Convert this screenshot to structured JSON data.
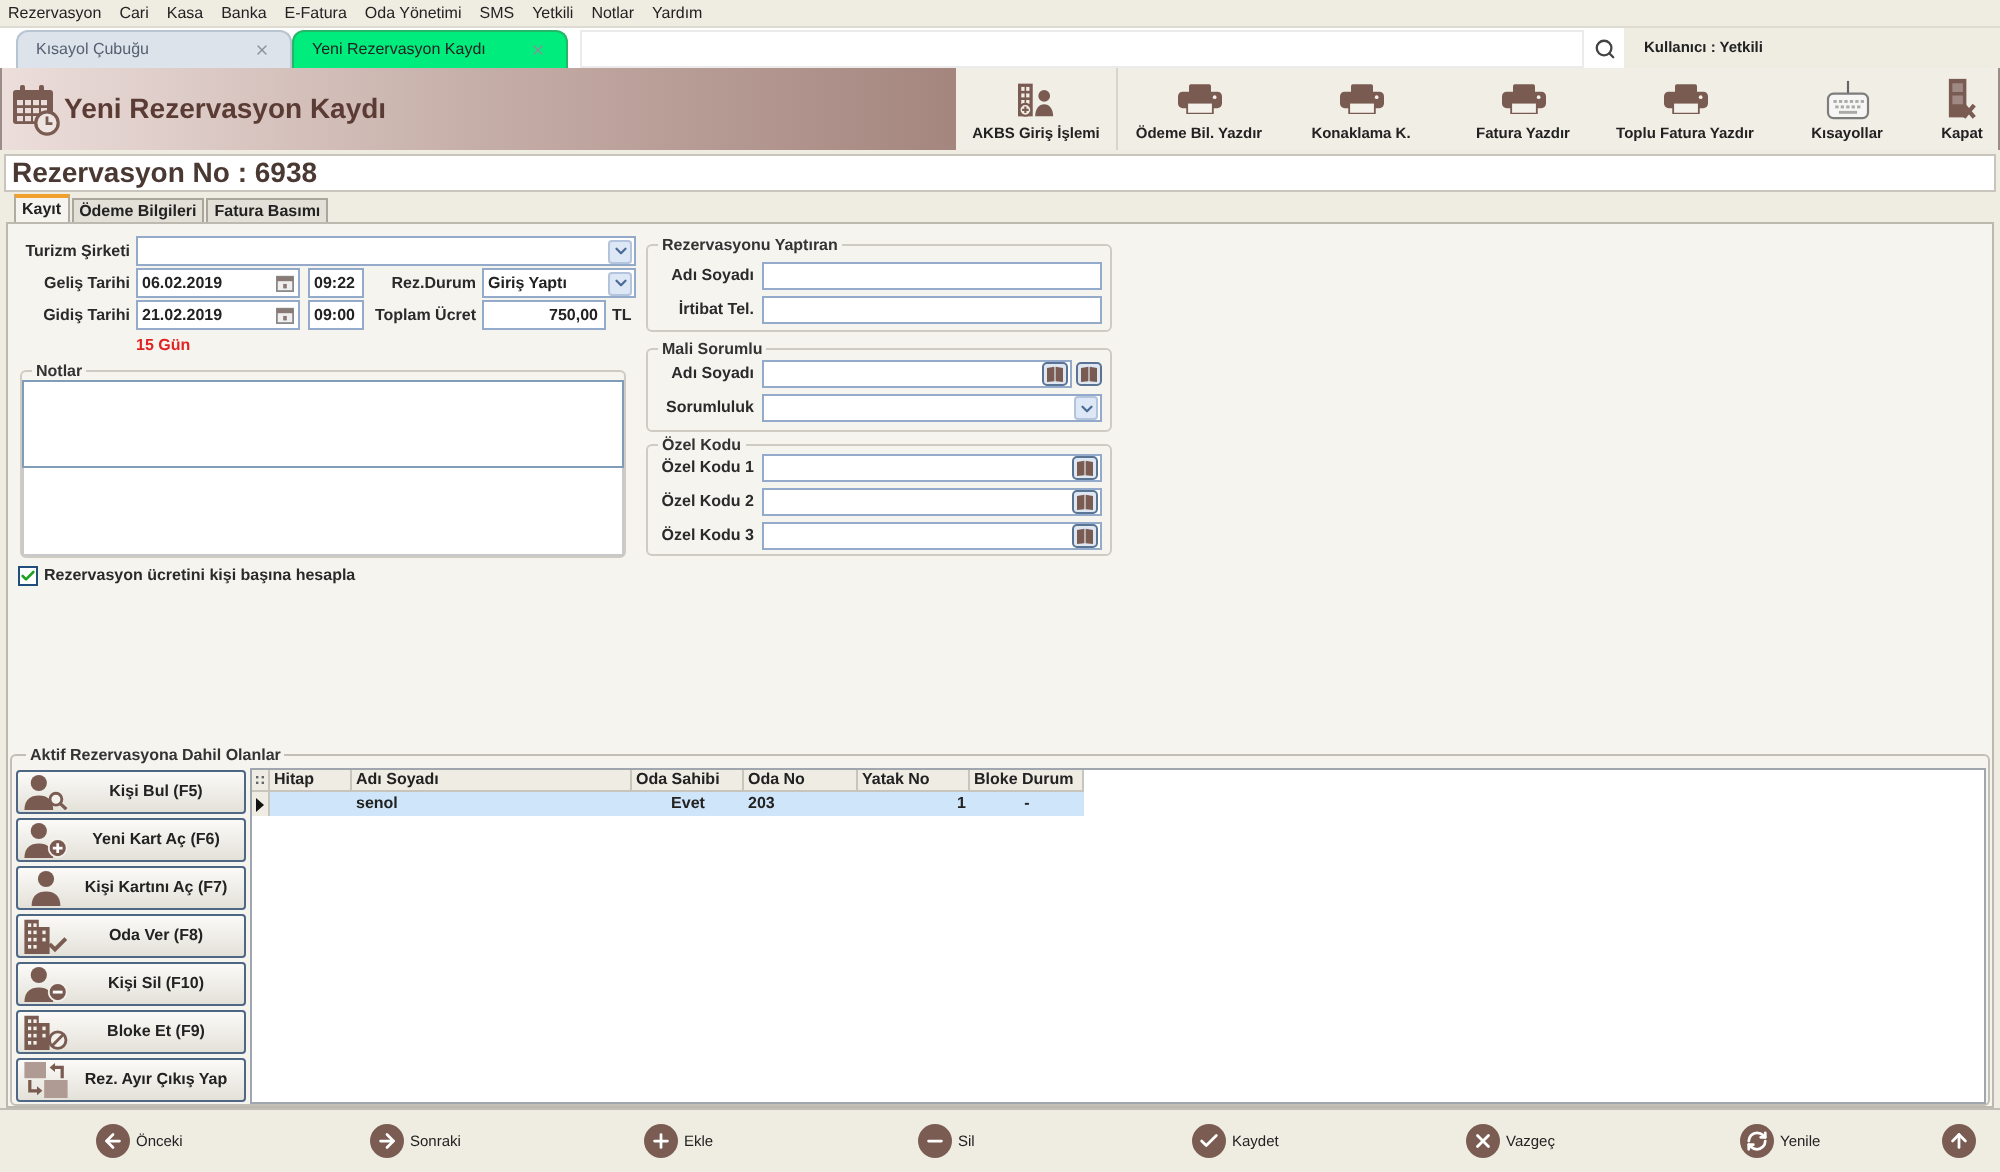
{
  "menu_bar": [
    "Rezervasyon",
    "Cari",
    "Kasa",
    "Banka",
    "E-Fatura",
    "Oda Yönetimi",
    "SMS",
    "Yetkili",
    "Notlar",
    "Yardım"
  ],
  "document_tabs": [
    {
      "label": "Kısayol Çubuğu",
      "selected": false
    },
    {
      "label": "Yeni Rezervasyon Kaydı",
      "selected": true
    }
  ],
  "user_label": "Kullanıcı : Yetkili",
  "header": {
    "title": "Yeni Rezervasyon Kaydı"
  },
  "toolbar": [
    {
      "label": "AKBS Giriş İşlemi",
      "kind": "entry"
    },
    {
      "label": "Ödeme Bil. Yazdır",
      "kind": "print"
    },
    {
      "label": "Konaklama K.",
      "kind": "print"
    },
    {
      "label": "Fatura Yazdır",
      "kind": "print"
    },
    {
      "label": "Toplu Fatura Yazdır",
      "kind": "print"
    },
    {
      "label": "Kısayollar",
      "kind": "shortcuts"
    },
    {
      "label": "Kapat",
      "kind": "close"
    }
  ],
  "reservation_no": "Rezervasyon No : 6938",
  "form_tabs": [
    {
      "label": "Kayıt",
      "selected": true
    },
    {
      "label": "Ödeme Bilgileri",
      "selected": false
    },
    {
      "label": "Fatura Basımı",
      "selected": false
    }
  ],
  "form": {
    "company": {
      "label": "Turizm Şirketi"
    },
    "arrival": {
      "label": "Geliş Tarihi",
      "date": "06.02.2019",
      "time": "09:22"
    },
    "departure": {
      "label": "Gidiş Tarihi",
      "date": "21.02.2019",
      "time": "09:00"
    },
    "status": {
      "label": "Rez.Durum",
      "value": "Giriş Yaptı"
    },
    "total": {
      "label": "Toplam Ücret",
      "value": "750,00",
      "currency": "TL"
    },
    "duration": "15 Gün",
    "notes": {
      "title": "Notlar"
    },
    "per_person": {
      "label": "Rezervasyon ücretini kişi başına hesapla",
      "checked": true
    }
  },
  "booker": {
    "title": "Rezervasyonu Yaptıran",
    "fields": [
      {
        "label": "Adı Soyadı",
        "kind": "text"
      },
      {
        "label": "İrtibat Tel.",
        "kind": "text"
      }
    ]
  },
  "payer": {
    "title": "Mali Sorumlu",
    "fields": [
      {
        "label": "Adı Soyadı",
        "kind": "lookup"
      },
      {
        "label": "Sorumluluk",
        "kind": "select"
      }
    ]
  },
  "special_codes": {
    "title": "Özel Kodu",
    "fields": [
      {
        "label": "Özel Kodu 1",
        "kind": "code"
      },
      {
        "label": "Özel Kodu 2",
        "kind": "code"
      },
      {
        "label": "Özel Kodu 3",
        "kind": "code"
      }
    ]
  },
  "members": {
    "title": "Aktif Rezervasyona Dahil Olanlar",
    "actions": [
      {
        "label": "Kişi Bul (F5)",
        "kind": "find"
      },
      {
        "label": "Yeni Kart Aç (F6)",
        "kind": "new"
      },
      {
        "label": "Kişi Kartını Aç (F7)",
        "kind": "open"
      },
      {
        "label": "Oda Ver (F8)",
        "kind": "room"
      },
      {
        "label": "Kişi Sil (F10)",
        "kind": "remove"
      },
      {
        "label": "Bloke Et (F9)",
        "kind": "block"
      },
      {
        "label": "Rez. Ayır Çıkış Yap",
        "kind": "split"
      }
    ],
    "table": {
      "columns": [
        "Hitap",
        "Adı Soyadı",
        "Oda Sahibi",
        "Oda No",
        "Yatak No",
        "Bloke Durum"
      ],
      "rows": [
        {
          "selected": true,
          "cells": [
            null,
            "senol",
            "Evet",
            "203",
            "1",
            "-"
          ]
        }
      ]
    }
  },
  "nav": [
    {
      "label": "Önceki",
      "kind": "prev"
    },
    {
      "label": "Sonraki",
      "kind": "next"
    },
    {
      "label": "Ekle",
      "kind": "add"
    },
    {
      "label": "Sil",
      "kind": "delete"
    },
    {
      "label": "Kaydet",
      "kind": "save"
    },
    {
      "label": "Vazgeç",
      "kind": "cancel"
    },
    {
      "label": "Yenile",
      "kind": "refresh"
    },
    {
      "kind": "up"
    }
  ]
}
